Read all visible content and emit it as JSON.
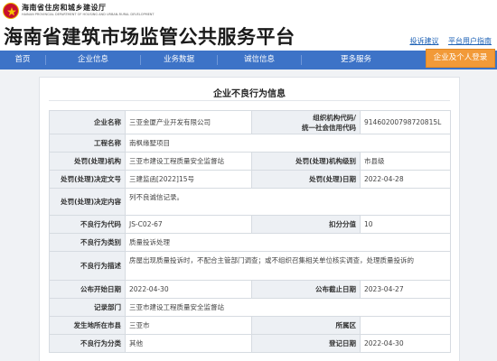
{
  "header": {
    "department": "海南省住房和城乡建设厅",
    "department_en": "HAINAN PROVINCIAL DEPARTMENT OF HOUSING AND URBAN-RURAL DEVELOPMENT",
    "site_title": "海南省建筑市场监管公共服务平台",
    "links": [
      "投诉建议",
      "平台用户指南"
    ]
  },
  "nav": {
    "items": [
      "首页",
      "企业信息",
      "业务数据",
      "诚信信息",
      "更多服务"
    ],
    "login_label": "企业及个人登录"
  },
  "record": {
    "title": "企业不良行为信息",
    "rows": {
      "company_name_label": "企业名称",
      "company_name": "三亚金厦产业开发有限公司",
      "org_code_label_1": "组织机构代码/",
      "org_code_label_2": "统一社会信用代码",
      "org_code": "91460200798720815L",
      "project_name_label": "工程名称",
      "project_name": "南枫缘墅项目",
      "penalty_org_label": "处罚(处理)机构",
      "penalty_org": "三亚市建设工程质量安全监督站",
      "penalty_level_label": "处罚(处理)机构级别",
      "penalty_level": "市县级",
      "decision_no_label": "处罚(处理)决定文号",
      "decision_no": "三建监函[2022]15号",
      "penalty_date_label": "处罚(处理)日期",
      "penalty_date": "2022-04-28",
      "decision_content_label": "处罚(处理)决定内容",
      "decision_content": "列不良诚信记录。",
      "behavior_code_label": "不良行为代码",
      "behavior_code": "JS-C02-67",
      "deduct_label": "扣分分值",
      "deduct": "10",
      "behavior_type_label": "不良行为类别",
      "behavior_type": "质量投诉处理",
      "behavior_desc_label": "不良行为描述",
      "behavior_desc": "房屋出现质量投诉时，不配合主管部门调查；或不组织召集相关单位核实调查，处理质量投诉的",
      "publish_start_label": "公布开始日期",
      "publish_start": "2022-04-30",
      "publish_end_label": "公布截止日期",
      "publish_end": "2023-04-27",
      "record_dept_label": "记录部门",
      "record_dept": "三亚市建设工程质量安全监督站",
      "region_label": "发生地所在市县",
      "region": "三亚市",
      "area_label": "所属区",
      "area": "",
      "category_label": "不良行为分类",
      "category": "其他",
      "register_date_label": "登记日期",
      "register_date": "2022-04-30"
    }
  }
}
